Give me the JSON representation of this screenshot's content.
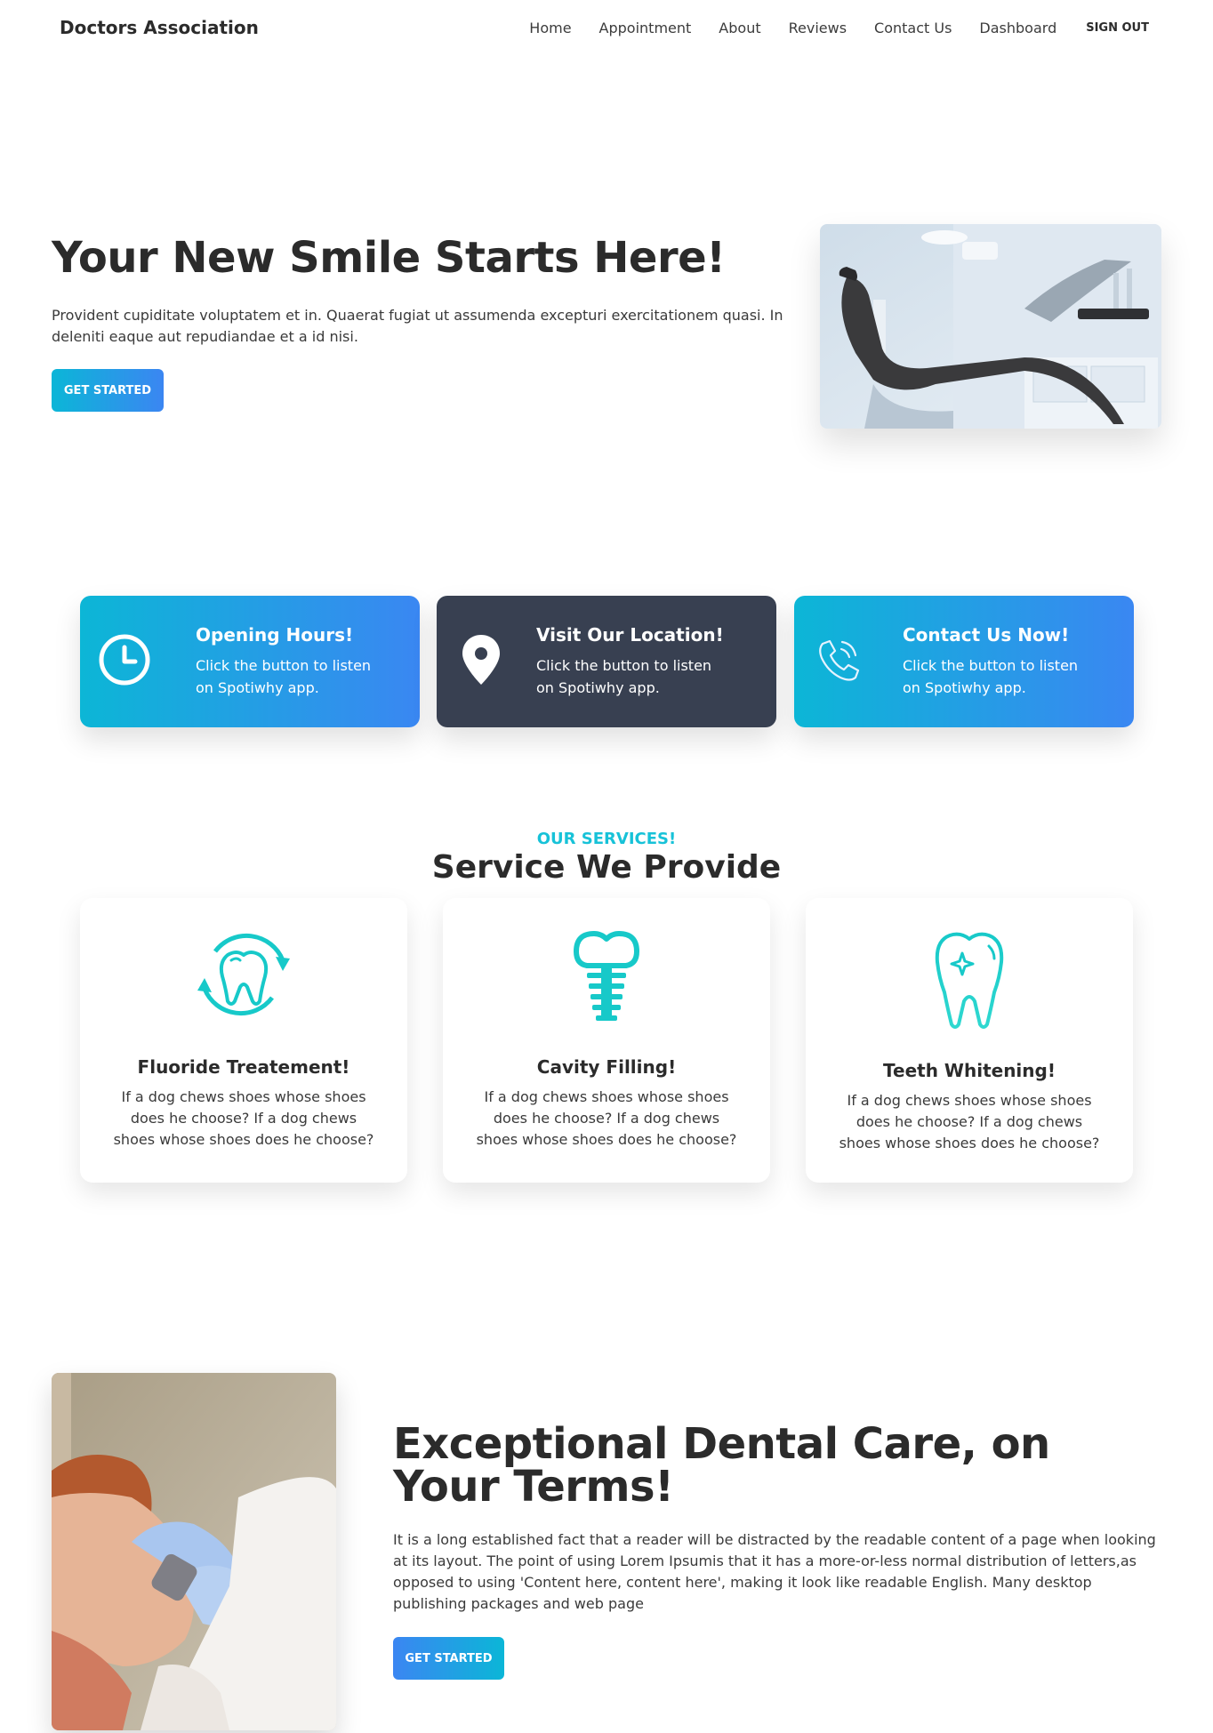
{
  "navbar": {
    "brand": "Doctors Association",
    "links": [
      "Home",
      "Appointment",
      "About",
      "Reviews",
      "Contact Us",
      "Dashboard"
    ],
    "sign_out": "SIGN OUT"
  },
  "hero": {
    "title": "Your New Smile Starts Here!",
    "text": "Provident cupiditate voluptatem et in. Quaerat fugiat ut assumenda excepturi exercitationem quasi. In deleniti eaque aut repudiandae et a id nisi.",
    "button": "GET STARTED",
    "image_icon": "dental-chair-photo"
  },
  "info_cards": [
    {
      "title": "Opening Hours!",
      "text": "Click the button to listen on Spotiwhy app.",
      "icon": "clock-icon",
      "style": "blue"
    },
    {
      "title": "Visit Our Location!",
      "text": "Click the button to listen on Spotiwhy app.",
      "icon": "location-pin-icon",
      "style": "dark"
    },
    {
      "title": "Contact Us Now!",
      "text": "Click the button to listen on Spotiwhy app.",
      "icon": "phone-icon",
      "style": "blue"
    }
  ],
  "services": {
    "kicker": "OUR SERVICES!",
    "heading": "Service We Provide",
    "items": [
      {
        "title": "Fluoride Treatement!",
        "text": "If a dog chews shoes whose shoes does he choose? If a dog chews shoes whose shoes does he choose?",
        "icon": "tooth-rotate-icon"
      },
      {
        "title": "Cavity Filling!",
        "text": "If a dog chews shoes whose shoes does he choose? If a dog chews shoes whose shoes does he choose?",
        "icon": "dental-implant-icon"
      },
      {
        "title": "Teeth Whitening!",
        "text": "If a dog chews shoes whose shoes does he choose? If a dog chews shoes whose shoes does he choose?",
        "icon": "sparkle-tooth-icon"
      }
    ]
  },
  "care": {
    "title": "Exceptional Dental Care, on Your Terms!",
    "text": "It is a long established fact that a reader will be distracted by the readable content of a page when looking at its layout. The point of using Lorem Ipsumis that it has a more-or-less normal distribution of letters,as opposed to using 'Content here, content here', making it look like readable English. Many desktop publishing packages and web page",
    "button": "GET STARTED",
    "image_icon": "child-dental-exam-photo"
  },
  "colors": {
    "accent_start": "#0bb6d7",
    "accent_end": "#3b86f2",
    "dark_card": "#384051",
    "teal_icon": "#17c9c9"
  }
}
